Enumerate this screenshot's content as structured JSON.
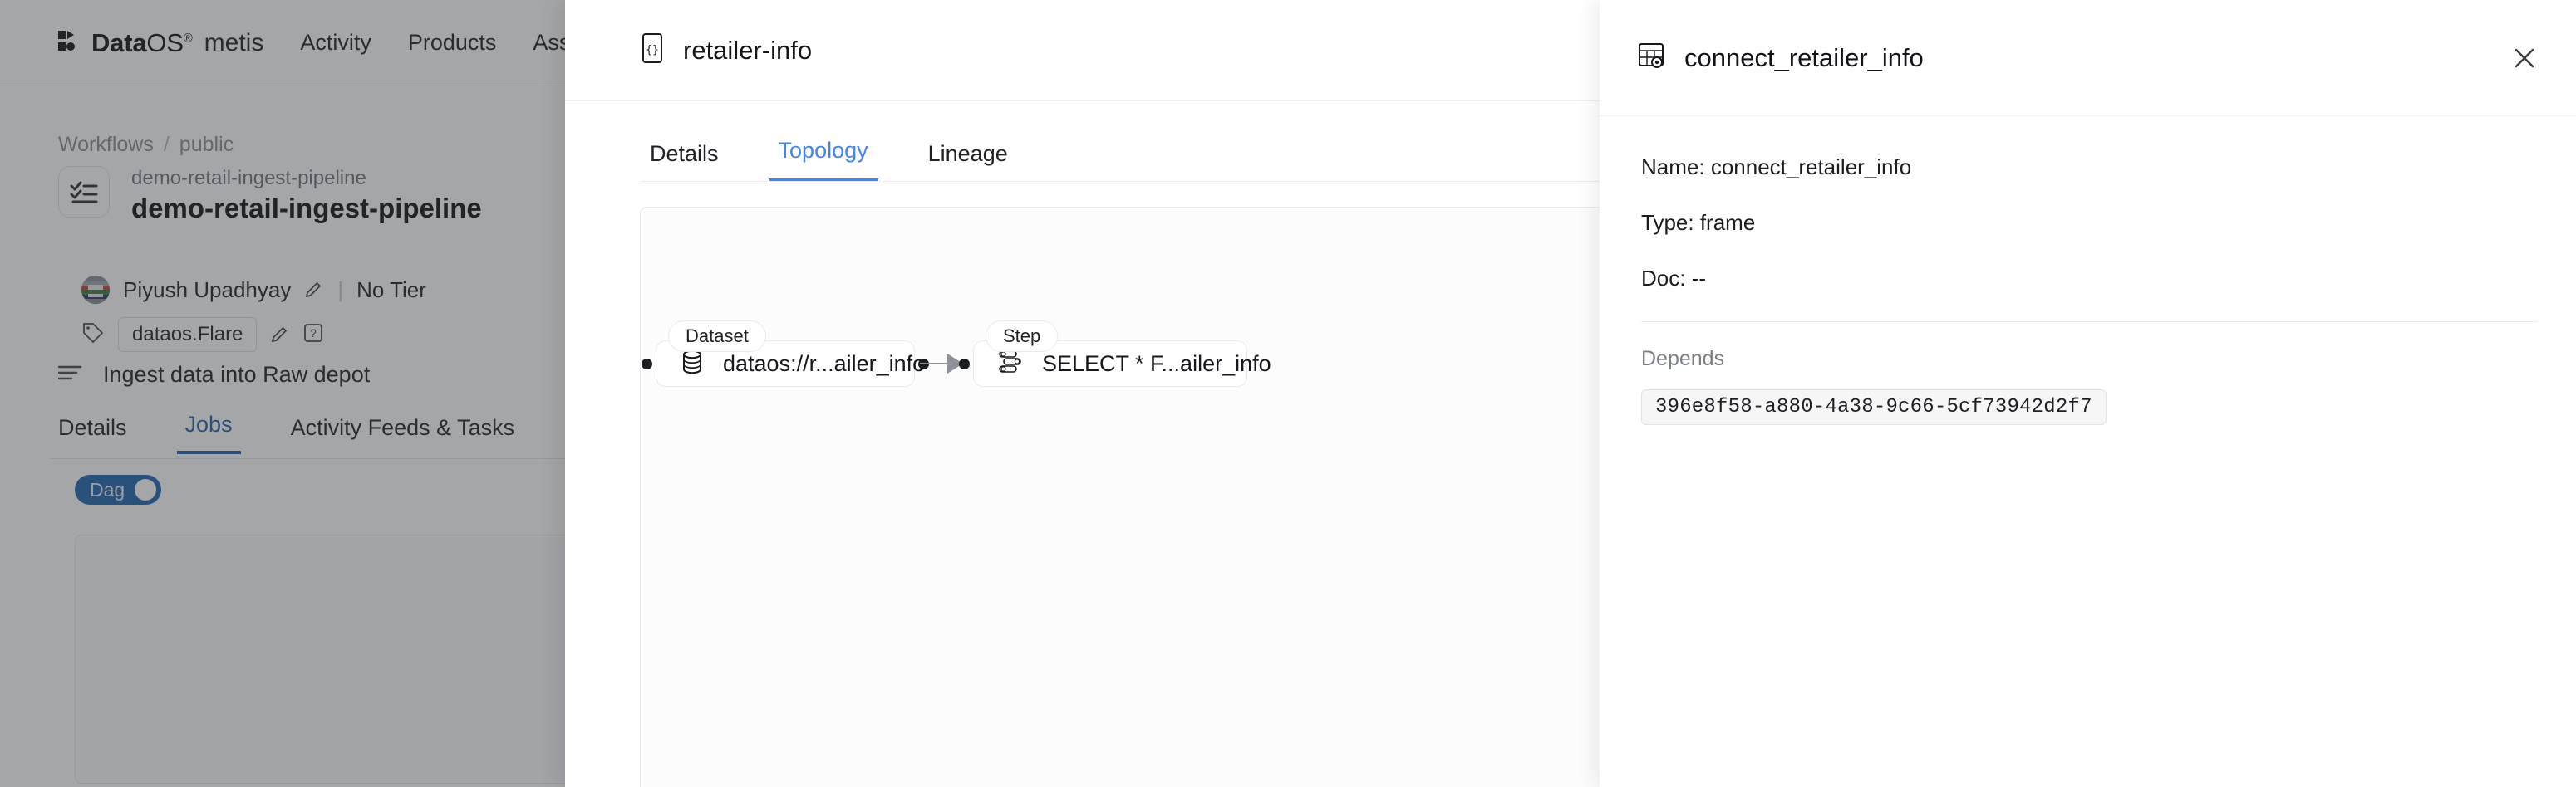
{
  "background": {
    "topnav": {
      "brand_bold": "Data",
      "brand_light": "OS",
      "brand_reg": "®",
      "brand_sub": "metis",
      "links": [
        "Activity",
        "Products",
        "Ass"
      ]
    },
    "breadcrumb": {
      "root": "Workflows",
      "separator": "/",
      "current": "public"
    },
    "entity": {
      "supertitle": "demo-retail-ingest-pipeline",
      "title": "demo-retail-ingest-pipeline",
      "icon": "checklist-icon"
    },
    "owner": {
      "name": "Piyush Upadhyay",
      "divider": "|",
      "tier": "No Tier"
    },
    "tags": {
      "icon": "tag-icon",
      "chips": [
        "dataos.Flare"
      ]
    },
    "description": {
      "icon": "description-icon",
      "text": "Ingest data into Raw depot"
    },
    "tabs": [
      {
        "label": "Details",
        "active": false
      },
      {
        "label": "Jobs",
        "active": true
      },
      {
        "label": "Activity Feeds & Tasks",
        "active": false
      }
    ],
    "dag_toggle": {
      "label": "Dag",
      "on": true
    }
  },
  "modal": {
    "title": "retailer-info",
    "title_icon": "json-braces-icon",
    "close_icon": "close-icon",
    "tabs": [
      {
        "label": "Details",
        "active": false
      },
      {
        "label": "Topology",
        "active": true
      },
      {
        "label": "Lineage",
        "active": false
      }
    ],
    "topology": {
      "nodes": [
        {
          "badge": "Dataset",
          "label": "dataos://r...ailer_info",
          "icon": "database-icon"
        },
        {
          "badge": "Step",
          "label": "SELECT * F...ailer_info",
          "icon": "numbered-list-icon"
        }
      ]
    }
  },
  "detail_panel": {
    "title": "connect_retailer_info",
    "title_icon": "table-icon",
    "close_icon": "close-icon",
    "fields": [
      {
        "label": "Name:",
        "value": "connect_retailer_info"
      },
      {
        "label": "Type:",
        "value": "frame"
      },
      {
        "label": "Doc:",
        "value": "--"
      }
    ],
    "depends": {
      "heading": "Depends",
      "items": [
        "396e8f58-a880-4a38-9c66-5cf73942d2f7"
      ]
    }
  },
  "colors": {
    "accent_blue": "#4285f4",
    "tab_blue": "#1f5fa9",
    "toggle_blue": "#1f63b0",
    "text_primary": "#16181c",
    "text_muted": "#7b7f86",
    "border": "#e9eaec"
  }
}
